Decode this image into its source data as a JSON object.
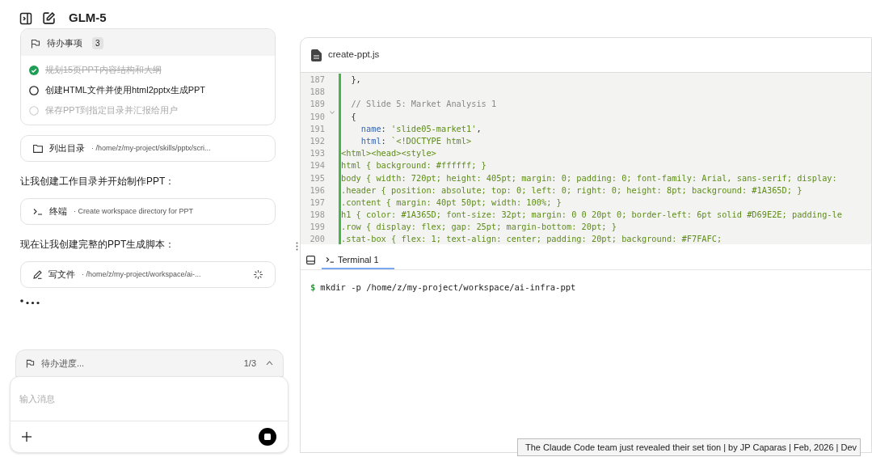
{
  "header": {
    "title": "GLM-5"
  },
  "todo_card": {
    "title": "待办事项",
    "count": "3",
    "items": [
      {
        "text": "规划15页PPT内容结构和大纲",
        "checked": true,
        "pending": false
      },
      {
        "text": "创建HTML文件并使用html2pptx生成PPT",
        "checked": false,
        "pending": false
      },
      {
        "text": "保存PPT到指定目录并汇报给用户",
        "checked": false,
        "pending": true
      }
    ]
  },
  "messages": [
    {
      "kind": "list",
      "label": "列出目录",
      "detail": "· /home/z/my-project/skills/pptx/scri...",
      "running": false
    },
    {
      "kind": "text",
      "text": "让我创建工作目录并开始制作PPT："
    },
    {
      "kind": "shell",
      "label": "终端",
      "detail": "· Create workspace directory for PPT",
      "running": false
    },
    {
      "kind": "text",
      "text": "现在让我创建完整的PPT生成脚本："
    },
    {
      "kind": "write",
      "label": "写文件",
      "detail": "· /home/z/my-project/workspace/ai-...",
      "running": true
    },
    {
      "kind": "typing"
    }
  ],
  "todo_progress": {
    "label": "待办进度...",
    "count": "1/3",
    "expanded": false
  },
  "composer": {
    "placeholder": "输入消息"
  },
  "editor": {
    "filename": "create-ppt.js",
    "lines": [
      {
        "number": "187",
        "fold": false,
        "segments": [
          {
            "kind": "plain",
            "text": "  },"
          }
        ]
      },
      {
        "number": "188",
        "fold": false
      },
      {
        "number": "189",
        "fold": false,
        "segments": [
          {
            "kind": "comment",
            "text": "  // Slide 5: Market Analysis 1"
          }
        ]
      },
      {
        "number": "190",
        "fold": true,
        "segments": [
          {
            "kind": "plain",
            "text": "  {"
          }
        ]
      },
      {
        "number": "191",
        "fold": false,
        "segments": [
          {
            "kind": "key",
            "text": "    name"
          },
          {
            "kind": "plain",
            "text": ": "
          },
          {
            "kind": "string",
            "text": "'slide05-market1'"
          },
          {
            "kind": "plain",
            "text": ","
          }
        ]
      },
      {
        "number": "192",
        "fold": false,
        "segments": [
          {
            "kind": "key",
            "text": "    html"
          },
          {
            "kind": "plain",
            "text": ": "
          },
          {
            "kind": "string",
            "text": "`<!DOCTYPE html>"
          }
        ]
      },
      {
        "number": "193",
        "fold": false,
        "segments": [
          {
            "kind": "string",
            "text": "<html><head><style>"
          }
        ]
      },
      {
        "number": "194",
        "fold": false,
        "segments": [
          {
            "kind": "string",
            "text": "html { background: #ffffff; }"
          }
        ]
      },
      {
        "number": "195",
        "fold": false,
        "segments": [
          {
            "kind": "string",
            "text": "body { width: 720pt; height: 405pt; margin: 0; padding: 0; font-family: Arial, sans-serif; display:"
          }
        ]
      },
      {
        "number": "196",
        "fold": false,
        "segments": [
          {
            "kind": "string",
            "text": ".header { position: absolute; top: 0; left: 0; right: 0; height: 8pt; background: #1A365D; }"
          }
        ]
      },
      {
        "number": "197",
        "fold": false,
        "segments": [
          {
            "kind": "string",
            "text": ".content { margin: 40pt 50pt; width: 100%; }"
          }
        ]
      },
      {
        "number": "198",
        "fold": false,
        "segments": [
          {
            "kind": "string",
            "text": "h1 { color: #1A365D; font-size: 32pt; margin: 0 0 20pt 0; border-left: 6pt solid #D69E2E; padding-le"
          }
        ]
      },
      {
        "number": "199",
        "fold": false,
        "segments": [
          {
            "kind": "string",
            "text": ".row { display: flex; gap: 25pt; margin-bottom: 20pt; }"
          }
        ]
      },
      {
        "number": "200",
        "fold": false,
        "segments": [
          {
            "kind": "string",
            "text": ".stat-box { flex: 1; text-align: center; padding: 20pt; background: #F7FAFC;"
          }
        ]
      }
    ]
  },
  "terminal": {
    "tab": "Terminal 1",
    "prompt": "$",
    "command": "mkdir -p /home/z/my-project/workspace/ai-infra-ppt"
  },
  "tooltip": {
    "text": "The Claude Code team just revealed their set  tion | by JP Caparas | Feb, 2026 | Dev"
  }
}
